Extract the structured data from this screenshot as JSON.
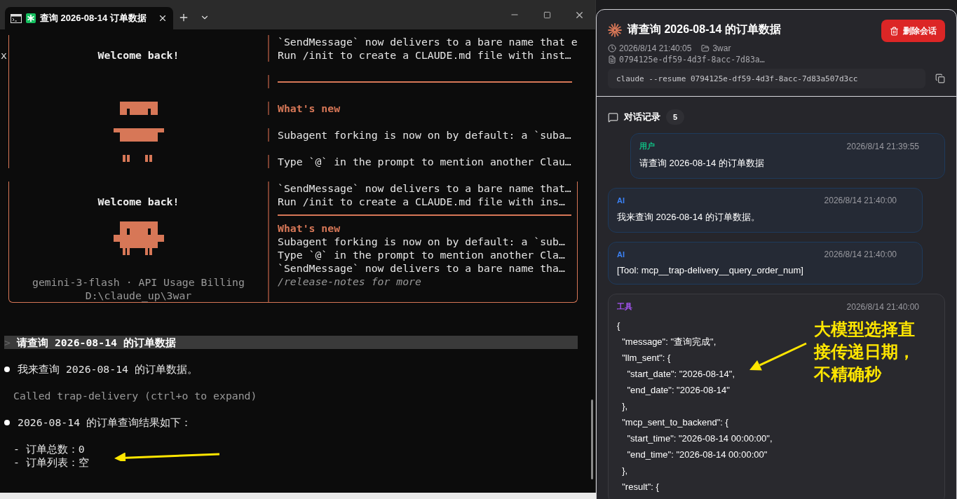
{
  "terminal": {
    "tabs": [
      {
        "title": "查询 2026-08-14 订单数据",
        "selected": true
      }
    ],
    "welcome_top": {
      "x_mark": "x",
      "greeting": "Welcome back!",
      "lines": [
        {
          "kind": "text",
          "text": "`SendMessage` now delivers to a bare name that e"
        },
        {
          "kind": "text",
          "text": "Run /init to create a CLAUDE.md file with inst…"
        },
        {
          "kind": "rule"
        },
        {
          "kind": "heading",
          "text": "What's new"
        },
        {
          "kind": "text",
          "text": "Subagent forking is now on by default: a `suba…"
        },
        {
          "kind": "text",
          "text": "Type `@` in the prompt to mention another Clau…"
        }
      ]
    },
    "welcome_bottom": {
      "greeting": "Welcome back!",
      "model": "gemini-3-flash · API Usage Billing",
      "path": "D:\\claude_up\\3war",
      "lines": [
        {
          "kind": "text",
          "text": "`SendMessage` now delivers to a bare name that…"
        },
        {
          "kind": "text",
          "text": "Run /init to create a CLAUDE.md file with ins…"
        },
        {
          "kind": "rule"
        },
        {
          "kind": "heading",
          "text": "What's new"
        },
        {
          "kind": "text",
          "text": "Subagent forking is now on by default: a `sub…"
        },
        {
          "kind": "text",
          "text": "Type `@` in the prompt to mention another Cla…"
        },
        {
          "kind": "text",
          "text": "`SendMessage` now delivers to a bare name tha…"
        },
        {
          "kind": "hint",
          "text": "/release-notes for more"
        }
      ]
    },
    "prompt": {
      "marker": ">",
      "text": "请查询 2026-08-14 的订单数据"
    },
    "output": [
      {
        "kind": "bullet",
        "text": "我来查询 2026-08-14 的订单数据。"
      },
      {
        "kind": "dim",
        "text": "Called trap-delivery (ctrl+o to expand)"
      },
      {
        "kind": "bullet",
        "text": "2026-08-14 的订单查询结果如下："
      },
      {
        "kind": "list",
        "text": "- 订单总数：0"
      },
      {
        "kind": "list",
        "text": "- 订单列表：空"
      }
    ]
  },
  "session": {
    "title": "请查询 2026-08-14 的订单数据",
    "delete_button": "删除会话",
    "time": "2026/8/14 21:40:05",
    "folder": "3war",
    "session_id": "0794125e-df59-4d3f-8acc-7d83a…",
    "command": "claude --resume 0794125e-df59-4d3f-8acc-7d83a507d3cc",
    "history_title": "对话记录",
    "history_count": "5",
    "messages": [
      {
        "kind": "user",
        "role": "用户",
        "time": "2026/8/14 21:39:55",
        "text": "请查询 2026-08-14 的订单数据"
      },
      {
        "kind": "ai",
        "role": "AI",
        "time": "2026/8/14 21:40:00",
        "text": "我来查询 2026-08-14 的订单数据。"
      },
      {
        "kind": "ai",
        "role": "AI",
        "time": "2026/8/14 21:40:00",
        "text": "[Tool: mcp__trap-delivery__query_order_num]"
      },
      {
        "kind": "tool",
        "role": "工具",
        "time": "2026/8/14 21:40:00",
        "lines": [
          "{",
          "  \"message\": \"查询完成\",",
          "  \"llm_sent\": {",
          "    \"start_date\": \"2026-08-14\",",
          "    \"end_date\": \"2026-08-14\"",
          "  },",
          "  \"mcp_sent_to_backend\": {",
          "    \"start_time\": \"2026-08-14 00:00:00\",",
          "    \"end_time\": \"2026-08-14 00:00:00\"",
          "  },",
          "  \"result\": {"
        ]
      }
    ]
  },
  "annotation": {
    "lines": [
      "大模型选择直",
      "接传递日期，",
      "不精确秒"
    ]
  }
}
